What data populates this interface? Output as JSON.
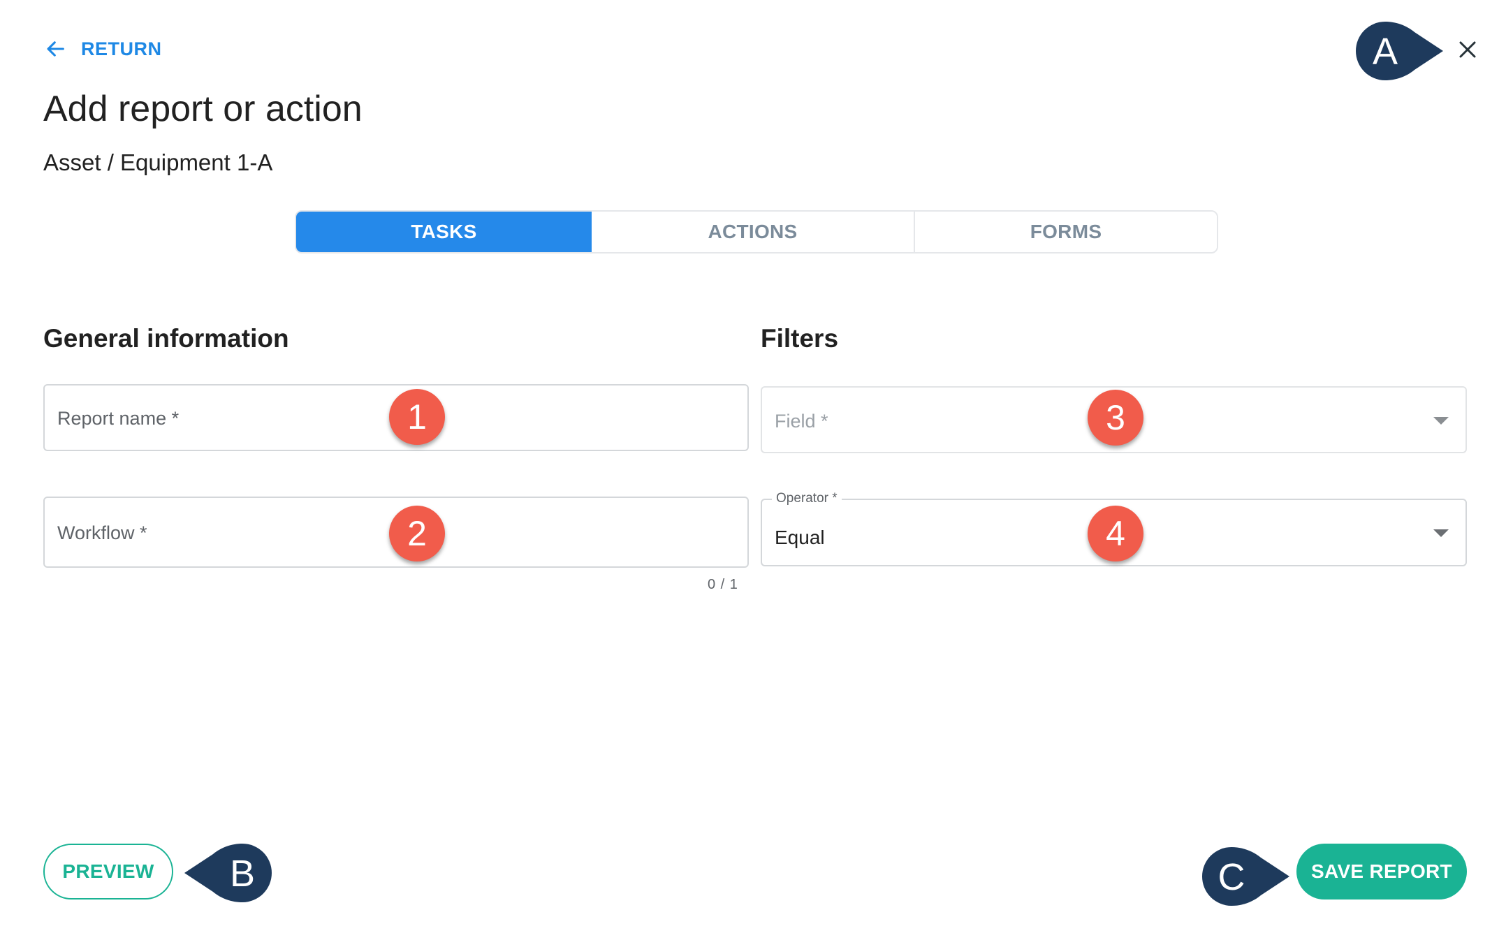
{
  "header": {
    "return_label": "RETURN",
    "title": "Add report or action",
    "breadcrumb": "Asset / Equipment 1-A"
  },
  "tabs": [
    {
      "label": "TASKS",
      "active": true
    },
    {
      "label": "ACTIONS",
      "active": false
    },
    {
      "label": "FORMS",
      "active": false
    }
  ],
  "general": {
    "heading": "General information",
    "report_name_placeholder": "Report name *",
    "workflow_placeholder": "Workflow *",
    "workflow_counter": "0 / 1"
  },
  "filters": {
    "heading": "Filters",
    "field_placeholder": "Field *",
    "operator_label": "Operator *",
    "operator_value": "Equal"
  },
  "badges": {
    "b1": "1",
    "b2": "2",
    "b3": "3",
    "b4": "4"
  },
  "callouts": {
    "a": "A",
    "b": "B",
    "c": "C"
  },
  "footer": {
    "preview_label": "PREVIEW",
    "save_label": "SAVE REPORT"
  },
  "colors": {
    "accent_blue": "#2589ea",
    "link_blue": "#1e88e5",
    "success_green": "#1ab394",
    "badge_red": "#f15c4b",
    "callout_navy": "#1e3a5c"
  },
  "icons": {
    "back": "arrow-left-icon",
    "close": "close-icon",
    "dropdown": "caret-down-icon"
  }
}
